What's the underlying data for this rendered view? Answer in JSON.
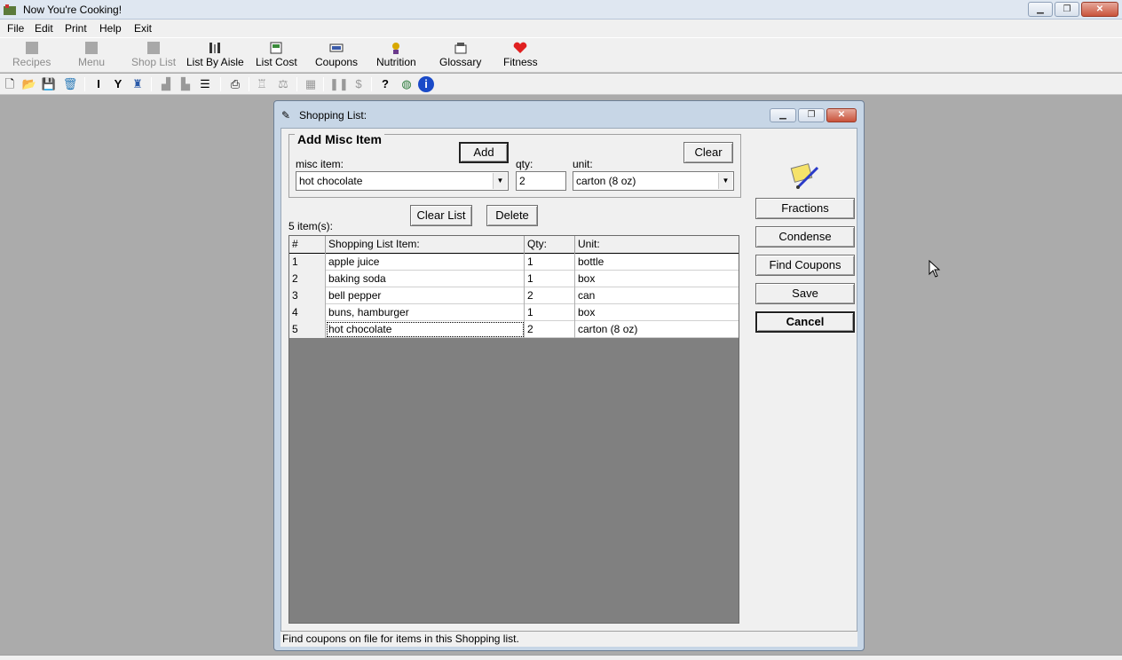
{
  "window": {
    "title": "Now You're Cooking!"
  },
  "menu": [
    "File",
    "Edit",
    "Print",
    "Help",
    "Exit"
  ],
  "toolbar": [
    {
      "label": "Recipes",
      "icon": "recipes-icon",
      "enabled": false
    },
    {
      "label": "Menu",
      "icon": "menu-icon",
      "enabled": false
    },
    {
      "label": "Shop List",
      "icon": "shop-list-icon",
      "enabled": false
    },
    {
      "label": "List By Aisle",
      "icon": "list-by-aisle-icon",
      "enabled": true
    },
    {
      "label": "List Cost",
      "icon": "list-cost-icon",
      "enabled": true
    },
    {
      "label": "Coupons",
      "icon": "coupons-icon",
      "enabled": true
    },
    {
      "label": "Nutrition",
      "icon": "nutrition-icon",
      "enabled": true
    },
    {
      "label": "Glossary",
      "icon": "glossary-icon",
      "enabled": true
    },
    {
      "label": "Fitness",
      "icon": "heart-icon",
      "enabled": true
    }
  ],
  "dialog": {
    "title": "Shopping List:",
    "add_group": {
      "legend": "Add Misc Item",
      "add_label": "Add",
      "clear_label": "Clear",
      "misc_item_label": "misc item:",
      "misc_item_value": "hot chocolate",
      "qty_label": "qty:",
      "qty_value": "2",
      "unit_label": "unit:",
      "unit_value": "carton (8 oz)"
    },
    "clear_list_label": "Clear List",
    "delete_label": "Delete",
    "item_count": "5 item(s):",
    "columns": [
      "#",
      "Shopping List Item:",
      "Qty:",
      "Unit:"
    ],
    "rows": [
      {
        "n": "1",
        "item": "apple juice",
        "qty": "1",
        "unit": "bottle"
      },
      {
        "n": "2",
        "item": "baking soda",
        "qty": "1",
        "unit": "box"
      },
      {
        "n": "3",
        "item": "bell pepper",
        "qty": "2",
        "unit": "can"
      },
      {
        "n": "4",
        "item": "buns, hamburger",
        "qty": "1",
        "unit": "box"
      },
      {
        "n": "5",
        "item": "hot chocolate",
        "qty": "2",
        "unit": "carton (8 oz)"
      }
    ],
    "side_buttons": {
      "fractions": "Fractions",
      "condense": "Condense",
      "find_coupons": "Find Coupons",
      "save": "Save",
      "cancel": "Cancel"
    },
    "status": "Find coupons on file for items in this Shopping list."
  }
}
